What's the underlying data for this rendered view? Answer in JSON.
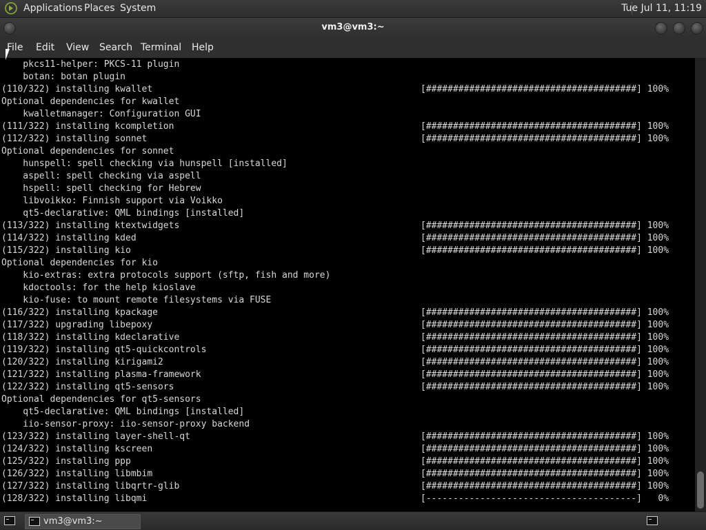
{
  "top_panel": {
    "menus": [
      "Applications",
      "Places",
      "System"
    ],
    "clock": "Tue Jul 11, 11:19"
  },
  "window": {
    "title": "vm3@vm3:~"
  },
  "menubar": [
    "File",
    "Edit",
    "View",
    "Search",
    "Terminal",
    "Help"
  ],
  "terminal": {
    "lines": [
      {
        "text": "    pkcs11-helper: PKCS-11 plugin",
        "progress": ""
      },
      {
        "text": "    botan: botan plugin",
        "progress": ""
      },
      {
        "text": "(110/322) installing kwallet",
        "progress": "[#######################################] 100%"
      },
      {
        "text": "Optional dependencies for kwallet",
        "progress": ""
      },
      {
        "text": "    kwalletmanager: Configuration GUI",
        "progress": ""
      },
      {
        "text": "(111/322) installing kcompletion",
        "progress": "[#######################################] 100%"
      },
      {
        "text": "(112/322) installing sonnet",
        "progress": "[#######################################] 100%"
      },
      {
        "text": "Optional dependencies for sonnet",
        "progress": ""
      },
      {
        "text": "    hunspell: spell checking via hunspell [installed]",
        "progress": ""
      },
      {
        "text": "    aspell: spell checking via aspell",
        "progress": ""
      },
      {
        "text": "    hspell: spell checking for Hebrew",
        "progress": ""
      },
      {
        "text": "    libvoikko: Finnish support via Voikko",
        "progress": ""
      },
      {
        "text": "    qt5-declarative: QML bindings [installed]",
        "progress": ""
      },
      {
        "text": "(113/322) installing ktextwidgets",
        "progress": "[#######################################] 100%"
      },
      {
        "text": "(114/322) installing kded",
        "progress": "[#######################################] 100%"
      },
      {
        "text": "(115/322) installing kio",
        "progress": "[#######################################] 100%"
      },
      {
        "text": "Optional dependencies for kio",
        "progress": ""
      },
      {
        "text": "    kio-extras: extra protocols support (sftp, fish and more)",
        "progress": ""
      },
      {
        "text": "    kdoctools: for the help kioslave",
        "progress": ""
      },
      {
        "text": "    kio-fuse: to mount remote filesystems via FUSE",
        "progress": ""
      },
      {
        "text": "(116/322) installing kpackage",
        "progress": "[#######################################] 100%"
      },
      {
        "text": "(117/322) upgrading libepoxy",
        "progress": "[#######################################] 100%"
      },
      {
        "text": "(118/322) installing kdeclarative",
        "progress": "[#######################################] 100%"
      },
      {
        "text": "(119/322) installing qt5-quickcontrols",
        "progress": "[#######################################] 100%"
      },
      {
        "text": "(120/322) installing kirigami2",
        "progress": "[#######################################] 100%"
      },
      {
        "text": "(121/322) installing plasma-framework",
        "progress": "[#######################################] 100%"
      },
      {
        "text": "(122/322) installing qt5-sensors",
        "progress": "[#######################################] 100%"
      },
      {
        "text": "Optional dependencies for qt5-sensors",
        "progress": ""
      },
      {
        "text": "    qt5-declarative: QML bindings [installed]",
        "progress": ""
      },
      {
        "text": "    iio-sensor-proxy: iio-sensor-proxy backend",
        "progress": ""
      },
      {
        "text": "(123/322) installing layer-shell-qt",
        "progress": "[#######################################] 100%"
      },
      {
        "text": "(124/322) installing kscreen",
        "progress": "[#######################################] 100%"
      },
      {
        "text": "(125/322) installing ppp",
        "progress": "[#######################################] 100%"
      },
      {
        "text": "(126/322) installing libmbim",
        "progress": "[#######################################] 100%"
      },
      {
        "text": "(127/322) installing libqrtr-glib",
        "progress": "[#######################################] 100%"
      },
      {
        "text": "(128/322) installing libqmi",
        "progress": "[---------------------------------------]   0%"
      }
    ]
  },
  "taskbar": {
    "task_label": "vm3@vm3:~"
  }
}
